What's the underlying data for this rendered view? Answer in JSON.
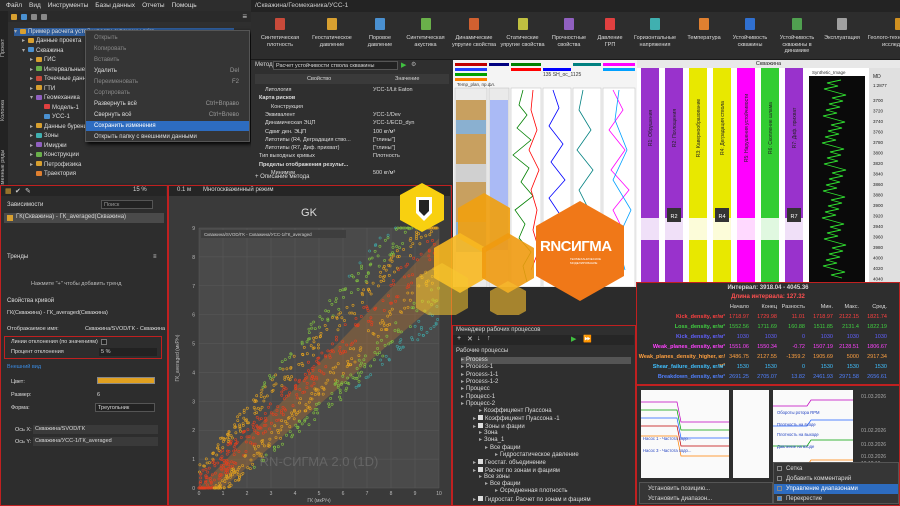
{
  "menu": [
    "Файл",
    "Вид",
    "Инструменты",
    "Базы данных",
    "Отчеты",
    "Помощь"
  ],
  "path": "/Скважина/Геомеханика/УСС-1",
  "vtabs": [
    "Проект",
    "Колонка",
    "Временные ряды",
    "Инструменты",
    "Дата-процессы",
    "Презентация",
    "Журнал"
  ],
  "tree": {
    "root": "Пример расчета устойчивости скважины.prjrs",
    "nodes": [
      {
        "label": "Данные проекта",
        "level": 1,
        "chev": "▸"
      },
      {
        "label": "Скважина",
        "level": 1,
        "chev": "▾"
      },
      {
        "label": "ГИС",
        "level": 2,
        "chev": "▸"
      },
      {
        "label": "Интервальные данные",
        "level": 2,
        "chev": "▸"
      },
      {
        "label": "Точечные данные",
        "level": 2,
        "chev": "▸"
      },
      {
        "label": "ГТИ",
        "level": 2,
        "chev": "▸"
      },
      {
        "label": "Геомеханика",
        "level": 2,
        "chev": "▾"
      },
      {
        "label": "Модель-1",
        "level": 3,
        "chev": ""
      },
      {
        "label": "УСС-1",
        "level": 3,
        "chev": ""
      },
      {
        "label": "Данные бурения",
        "level": 2,
        "chev": "▸"
      },
      {
        "label": "Зоны",
        "level": 2,
        "chev": "▸"
      },
      {
        "label": "Имиджи",
        "level": 2,
        "chev": "▸"
      },
      {
        "label": "Конструкции",
        "level": 2,
        "chev": "▸"
      },
      {
        "label": "Петрофизика",
        "level": 2,
        "chev": "▸"
      },
      {
        "label": "Траектория",
        "level": 2,
        "chev": ""
      }
    ]
  },
  "context_menu": [
    {
      "label": "Открыть",
      "shortcut": "",
      "enabled": false
    },
    {
      "label": "Копировать",
      "shortcut": "",
      "enabled": false
    },
    {
      "label": "Вставить",
      "shortcut": "",
      "enabled": false
    },
    {
      "label": "Удалить",
      "shortcut": "Del",
      "enabled": true
    },
    {
      "label": "Переименовать",
      "shortcut": "F2",
      "enabled": false
    },
    {
      "label": "Сортировать",
      "shortcut": "",
      "enabled": false
    },
    {
      "label": "Развернуть всё",
      "shortcut": "Ctrl+Вправо",
      "enabled": true
    },
    {
      "label": "Свернуть всё",
      "shortcut": "Ctrl+Влево",
      "enabled": true
    },
    {
      "label": "Сохранить изменения",
      "shortcut": "",
      "enabled": true,
      "highlight": true
    },
    {
      "label": "Открыть папку с внешними данными",
      "shortcut": "",
      "enabled": true
    }
  ],
  "ribbon": [
    {
      "label": "Синтетическая плотность",
      "color": "#c84a3a"
    },
    {
      "label": "Геостатическое давление",
      "color": "#d8a030"
    },
    {
      "label": "Поровое давление",
      "color": "#4a90d0"
    },
    {
      "label": "Синтетическая акустика",
      "color": "#6ab04a"
    },
    {
      "label": "Динамические упругие свойства",
      "color": "#d06030"
    },
    {
      "label": "Статические упругие свойства",
      "color": "#c0c040"
    },
    {
      "label": "Прочностные свойства",
      "color": "#9060c0"
    },
    {
      "label": "Давление ГРП",
      "color": "#e04040"
    },
    {
      "label": "Горизонтальные напряжения",
      "color": "#40b0b0"
    },
    {
      "label": "Температура",
      "color": "#e08030"
    },
    {
      "label": "Устойчивость скважины",
      "color": "#3070d0"
    },
    {
      "label": "Устойчивость скважины в динамике",
      "color": "#50a050"
    },
    {
      "label": "Эксплуатация",
      "color": "#a0a0a0"
    },
    {
      "label": "Геолого-технологические исследования",
      "color": "#d09020"
    }
  ],
  "method": {
    "label": "Метод",
    "value": "Расчет устойчивости ствола скважины",
    "col_prop": "Свойство",
    "col_val": "Значение",
    "rows": [
      {
        "k": "Литология",
        "v": "УСС-1/Lit Eaton",
        "ind": 1
      },
      {
        "k": "Карта рисков",
        "v": "",
        "ind": 0,
        "bold": true
      },
      {
        "k": "Конструкция",
        "v": "",
        "ind": 2
      },
      {
        "k": "Эквивалент",
        "v": "УСС-1/Dev",
        "ind": 1
      },
      {
        "k": "Динамическая ЭЦП",
        "v": "УСС-1/ECD_dyn",
        "ind": 1
      },
      {
        "k": "Сдвиг ден. ЭЦП",
        "v": "100 кг/м³",
        "ind": 1
      },
      {
        "k": "Литотипы (R4, Деградация ство...",
        "v": "[\"глины\"]",
        "ind": 1
      },
      {
        "k": "Литотипы (R7, Диф. прихват)",
        "v": "[\"глины\"]",
        "ind": 1
      },
      {
        "k": "Тип выходных кривых",
        "v": "Плотность",
        "ind": 0
      },
      {
        "k": "Пределы отображения результ...",
        "v": "",
        "ind": 0,
        "bold": true
      },
      {
        "k": "Минимум",
        "v": "500 кг/м³",
        "ind": 2
      }
    ],
    "footer": "Описание метода"
  },
  "logs": {
    "header": "135 SH_ос_1125",
    "sub": "Temp_plan, пр.фл."
  },
  "well": {
    "title": "Скважина",
    "track_title": "Synthetic_Image",
    "md_label": "MD",
    "scale": "1:2877",
    "depths": [
      "3700",
      "3720",
      "3740",
      "3760",
      "3780",
      "3800",
      "3820",
      "3840",
      "3860",
      "3880",
      "3900",
      "3920",
      "3940",
      "3960",
      "3980",
      "4000",
      "4020",
      "4040"
    ],
    "bars": [
      {
        "label": "R1: Обрушения",
        "color": "#9932cc"
      },
      {
        "label": "R2: Поглощения",
        "color": "#9932cc"
      },
      {
        "label": "R3: Кавернообразование",
        "color": "#e8e800"
      },
      {
        "label": "R4: Деградация ствола",
        "color": "#e8e800"
      },
      {
        "label": "R5: Нарушения устойчивости",
        "color": "#ff00ff"
      },
      {
        "label": "R6: Скопление шлама",
        "color": "#32cd32"
      },
      {
        "label": "R7: Диф. прихват",
        "color": "#9932cc"
      }
    ],
    "tag_labels": [
      "R2",
      "R4",
      "R7"
    ]
  },
  "left": {
    "deps": "Зависимости",
    "search": "Поиск",
    "dep_item": "ГК(Скважина) - ГК_averaged(Скважина)",
    "trends": "Тренды",
    "trend_hint": "Нажмите \"+\" чтобы добавить тренд",
    "curve_props": "Свойства кривой",
    "curve_name": "ГК(Скважина) - ГК_averaged(Скважина)",
    "display_label": "Отображаемое имя:",
    "display_val": "Скважина/SVOD/ГК - Скважина",
    "dev_lines": "Линии отклонения (по значениям)",
    "dev_pct": "Процент отклонения",
    "dev_pct_val": "5 %",
    "view": "Внешний вид",
    "color_l": "Цвет:",
    "size_l": "Размер:",
    "size_v": "6",
    "shape_l": "Форма:",
    "shape_v": "Треугольник",
    "axx_l": "Ось X:",
    "axx_v": "Скважина/SVOD/ГК",
    "axy_l": "Ось Y:",
    "axy_v": "Скважина/УСС-1/ГК_averaged",
    "zoom": "15 %",
    "mult": "0.1 м",
    "mode": "Многоскважинный режим"
  },
  "crossplot": {
    "title": "GK",
    "legend": "Скважина/SVOD/ГК - Скважина/УСС-1/ГК_averaged",
    "xlabel": "ГК (мкР/ч)",
    "ylabel": "ГК_averaged (мкР/ч)",
    "xticks": [
      "0",
      "1",
      "2",
      "3",
      "4",
      "5",
      "6",
      "7",
      "8",
      "9",
      "10"
    ],
    "yticks": [
      "0",
      "1",
      "2",
      "3",
      "4",
      "5",
      "6",
      "7",
      "8",
      "9"
    ],
    "watermark": "RN-СИГМА 2.0 (1D)"
  },
  "logo": {
    "text": "RNСИГМА",
    "sub": "ГЕОМЕХАНИЧЕСКОЕ МОДЕЛИРОВАНИЕ"
  },
  "stats": {
    "interval": "Интервал: 3918.04 - 4045.36",
    "len": "Длина интервала: 127.32",
    "cols": [
      "Начало",
      "Конец",
      "Разность",
      "Мин.",
      "Макс.",
      "Сред."
    ],
    "rows": [
      {
        "name": "Kick_density, кг/м³",
        "vals": [
          "1718.97",
          "1729.98",
          "11.01",
          "1718.97",
          "2122.15",
          "1821.74"
        ],
        "color": "#ff4040"
      },
      {
        "name": "Loss_density, кг/м³",
        "vals": [
          "1552.56",
          "1711.69",
          "160.88",
          "1511.85",
          "2131.4",
          "1822.19"
        ],
        "color": "#40d040"
      },
      {
        "name": "Kick_density, кг/м³",
        "vals": [
          "1030",
          "1030",
          "0",
          "1030",
          "1030",
          "1030"
        ],
        "color": "#6060ff"
      },
      {
        "name": "Weak_planes_density, кг/м³",
        "vals": [
          "1551.06",
          "1550.34",
          "-0.72",
          "1507.19",
          "2128.51",
          "1806.67"
        ],
        "color": "#ff40ff"
      },
      {
        "name": "Weak_planes_density_higher, кг/м³",
        "vals": [
          "3486.75",
          "2127.55",
          "-1359.2",
          "1905.69",
          "5000",
          "2917.34"
        ],
        "color": "#ffa040"
      },
      {
        "name": "Shear_failure_density, кг/м³",
        "vals": [
          "1530",
          "1530",
          "0",
          "1530",
          "1530",
          "1530"
        ],
        "color": "#40c0ff"
      },
      {
        "name": "Breakdown_density, кг/м³",
        "vals": [
          "2691.25",
          "2705.07",
          "13.82",
          "2461.93",
          "2971.58",
          "2656.61"
        ],
        "color": "#5080ff"
      }
    ]
  },
  "proc": {
    "title": "Менеджер рабочих процессов",
    "sub": "Рабочие процессы",
    "items": [
      {
        "label": "Process",
        "x": 2,
        "chk": false
      },
      {
        "label": "Process-1",
        "x": 2,
        "chk": false
      },
      {
        "label": "Process-1-1",
        "x": 2,
        "chk": false
      },
      {
        "label": "Process-1-2",
        "x": 2,
        "chk": false
      },
      {
        "label": "Процесс",
        "x": 2,
        "chk": false
      },
      {
        "label": "Процесс-1",
        "x": 2,
        "chk": false
      },
      {
        "label": "Процесс-2",
        "x": 2,
        "chk": false
      },
      {
        "label": "Коэффициент Пуассона",
        "x": 20,
        "chk": false
      },
      {
        "label": "Коэффициент Пуассона -1",
        "x": 14,
        "chk": true
      },
      {
        "label": "Зоны и фации",
        "x": 14,
        "chk": true
      },
      {
        "label": "Зона",
        "x": 20,
        "chk": false
      },
      {
        "label": "Зона_1",
        "x": 20,
        "chk": false
      },
      {
        "label": "Все фации",
        "x": 26,
        "chk": false
      },
      {
        "label": "Гидростатическое давление",
        "x": 36,
        "chk": false
      },
      {
        "label": "Геостат. объединение",
        "x": 14,
        "chk": true
      },
      {
        "label": "Расчет по зонам и фациям",
        "x": 14,
        "chk": true
      },
      {
        "label": "Все зоны",
        "x": 20,
        "chk": false
      },
      {
        "label": "Все фации",
        "x": 26,
        "chk": false
      },
      {
        "label": "Осредненная плотность",
        "x": 36,
        "chk": false
      },
      {
        "label": "Гидростат. Расчет по зонам и фациям",
        "x": 14,
        "chk": true
      }
    ]
  },
  "minis": {
    "dates": [
      "01.03.2026",
      "01.02.2026",
      "01.03.2026",
      "01.03.2026",
      "10:12:16"
    ],
    "labels": [
      "Насос 1 - Частота ходо...",
      "Насос 3 - Частота ходо...",
      "Обороты ротора RPM",
      "Плотность на входе",
      "Плотность на выходе",
      "Давление на входе"
    ],
    "menu": [
      {
        "label": "Установить позицию...",
        "hi": false
      },
      {
        "label": "Установить диапазон...",
        "hi": false
      }
    ],
    "submenu": [
      {
        "label": "Сетка",
        "chk": false
      },
      {
        "label": "Добавить комментарий",
        "chk": false
      },
      {
        "label": "Управление диапазонами",
        "hi": true
      },
      {
        "label": "Перекрестие",
        "chk": true
      }
    ]
  }
}
